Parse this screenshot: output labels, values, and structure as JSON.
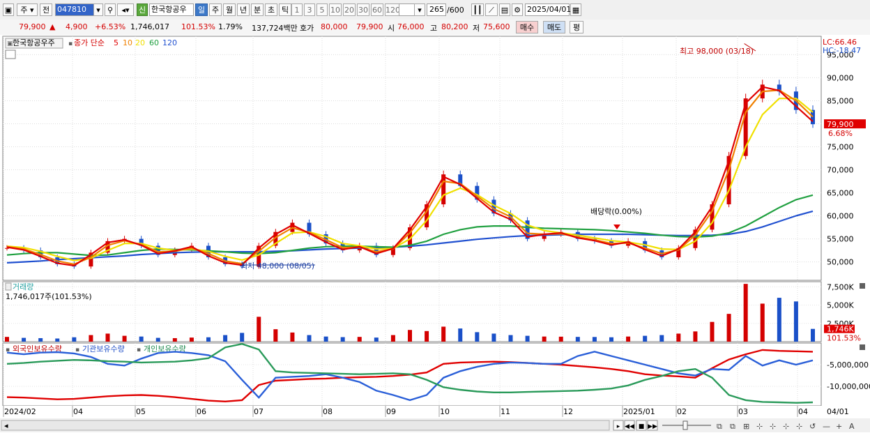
{
  "toolbar": {
    "market": "주",
    "prefix": "전",
    "code": "047810",
    "name": "한국항공우",
    "badge": "신",
    "periods": [
      "일",
      "주",
      "월",
      "년",
      "분",
      "초",
      "틱"
    ],
    "active_period": "일",
    "multipliers": [
      "1",
      "3",
      "5",
      "10",
      "20",
      "30",
      "60",
      "120"
    ],
    "count": "265",
    "count_total": "/600",
    "date": "2025/04/01"
  },
  "quote": {
    "price": "79,900",
    "direction": "▲",
    "change": "4,900",
    "change_rate": "+6.53%",
    "volume": "1,746,017",
    "volume_rate": "101.53%",
    "turnover": "1.79%",
    "value": "137,724백만",
    "ask_label": "호가",
    "ask1": "80,000",
    "ask2": "79,900",
    "open_label": "시",
    "open": "76,000",
    "high_label": "고",
    "high": "80,200",
    "low_label": "저",
    "low": "75,600",
    "buy": "매수",
    "sell": "매도",
    "avg": "평"
  },
  "colors": {
    "up": "#d40000",
    "down": "#1a50c8",
    "ma5": "#e00000",
    "ma10": "#f08000",
    "ma20": "#f0e000",
    "ma60": "#20a040",
    "ma120": "#2050d0"
  },
  "chart_data": [
    {
      "type": "line",
      "panel": "price",
      "title": "한국항공우주",
      "legend": [
        "종가 단순",
        "5",
        "10",
        "20",
        "60",
        "120"
      ],
      "yticks": [
        "95,000",
        "90,000",
        "85,000",
        "80,000",
        "75,000",
        "70,000",
        "65,000",
        "60,000",
        "55,000",
        "50,000"
      ],
      "ylim": [
        46000,
        99000
      ],
      "lc": "LC:66.46",
      "hc": "HC:-18.47",
      "last_price": "79,900",
      "last_rate": "6.68%",
      "annotations": {
        "high": "최고 98,000 (03/18)",
        "low": "최저 48,000 (08/05)",
        "dividend": "배당락(0.00%)"
      },
      "x": [
        "2024/02",
        "04",
        "05",
        "06",
        "07",
        "08",
        "09",
        "10",
        "11",
        "12",
        "2025/01",
        "02",
        "03",
        "04"
      ],
      "series": [
        {
          "name": "종가",
          "values": [
            53000,
            52500,
            51000,
            49500,
            49000,
            52000,
            54500,
            55000,
            53500,
            51500,
            52500,
            53500,
            51000,
            49500,
            49000,
            53500,
            56500,
            58500,
            56000,
            54000,
            52500,
            53500,
            51500,
            53000,
            57500,
            62500,
            69000,
            66500,
            63500,
            60500,
            59000,
            55000,
            56000,
            56500,
            55000,
            54500,
            53500,
            54500,
            52500,
            51000,
            53000,
            57000,
            62500,
            73000,
            85500,
            88500,
            87000,
            83000,
            79900
          ]
        },
        {
          "name": "5",
          "values": [
            53200,
            52600,
            51200,
            49700,
            49200,
            51600,
            54200,
            54800,
            53600,
            51800,
            52400,
            53300,
            51300,
            49800,
            49300,
            53000,
            56000,
            58000,
            56200,
            54300,
            52700,
            53300,
            51800,
            52900,
            57000,
            62000,
            68500,
            66800,
            63800,
            60800,
            59200,
            55400,
            56000,
            56300,
            55200,
            54600,
            53700,
            54300,
            52700,
            51300,
            52800,
            56500,
            62000,
            72000,
            84500,
            88000,
            87200,
            83800,
            80500
          ]
        },
        {
          "name": "10",
          "values": [
            53300,
            52800,
            51600,
            50200,
            49500,
            51000,
            53600,
            54600,
            53800,
            52200,
            52300,
            53000,
            51800,
            50200,
            49600,
            52300,
            55300,
            57400,
            56400,
            54800,
            53100,
            53200,
            52200,
            52800,
            56300,
            61000,
            67500,
            67000,
            64300,
            61500,
            59800,
            56200,
            56000,
            56100,
            55400,
            54800,
            54000,
            54100,
            53000,
            51800,
            52600,
            55800,
            61000,
            70000,
            82500,
            87000,
            87300,
            85000,
            81500
          ]
        },
        {
          "name": "20",
          "values": [
            53400,
            53100,
            52300,
            51200,
            50300,
            50800,
            52500,
            54000,
            54000,
            53000,
            52500,
            52800,
            52300,
            51200,
            50400,
            51500,
            54000,
            56300,
            56500,
            55500,
            54000,
            53500,
            52800,
            52900,
            55000,
            59000,
            64500,
            66000,
            64600,
            62300,
            60500,
            58000,
            56800,
            56300,
            55800,
            55200,
            54600,
            54300,
            53700,
            52800,
            52700,
            54500,
            58500,
            65500,
            75000,
            82000,
            85500,
            85500,
            82500
          ]
        },
        {
          "name": "60",
          "values": [
            51500,
            51800,
            52000,
            52000,
            51700,
            51400,
            51500,
            52000,
            52500,
            52800,
            52700,
            52600,
            52400,
            52200,
            51900,
            51800,
            52000,
            52500,
            53000,
            53300,
            53400,
            53400,
            53300,
            53200,
            53600,
            54500,
            56000,
            57000,
            57600,
            57800,
            57800,
            57500,
            57300,
            57200,
            57100,
            57000,
            56800,
            56500,
            56200,
            55800,
            55500,
            55400,
            55600,
            56300,
            57800,
            59800,
            61800,
            63500,
            64500
          ]
        },
        {
          "name": "120",
          "values": [
            49800,
            50000,
            50200,
            50500,
            50700,
            50900,
            51100,
            51300,
            51600,
            51800,
            52000,
            52100,
            52200,
            52200,
            52200,
            52200,
            52300,
            52400,
            52600,
            52800,
            52900,
            53000,
            53100,
            53200,
            53400,
            53700,
            54100,
            54500,
            54900,
            55200,
            55500,
            55700,
            55800,
            55900,
            56000,
            56000,
            56000,
            56000,
            55900,
            55800,
            55700,
            55700,
            55800,
            56000,
            56600,
            57600,
            58800,
            60000,
            61000
          ]
        }
      ]
    },
    {
      "type": "bar",
      "panel": "volume",
      "title": "거래량",
      "current": "1,746,017주(101.53%)",
      "yticks": [
        "7,500K",
        "5,000K",
        "2,500K"
      ],
      "ylim": [
        0,
        8200
      ],
      "last_label": "1,746K",
      "last_rate": "101.53%",
      "values": [
        650,
        520,
        480,
        430,
        600,
        900,
        1100,
        800,
        700,
        520,
        480,
        560,
        600,
        900,
        1200,
        3400,
        1700,
        1250,
        900,
        700,
        620,
        650,
        560,
        900,
        1600,
        1450,
        2050,
        1800,
        1300,
        1100,
        900,
        800,
        700,
        680,
        650,
        640,
        600,
        700,
        800,
        900,
        1100,
        1400,
        2700,
        3800,
        7900,
        5200,
        6000,
        5500,
        1746
      ]
    },
    {
      "type": "line",
      "panel": "holdings",
      "legend": [
        "외국인보유수량",
        "기관보유수량",
        "개인보유수량"
      ],
      "yticks": [
        "-5,000,000",
        "-10,000,000"
      ],
      "ylim": [
        -14500000,
        0
      ],
      "series": [
        {
          "name": "외국인보유수량",
          "values": [
            -12500000,
            -12600000,
            -12800000,
            -13000000,
            -12900000,
            -12600000,
            -12300000,
            -12100000,
            -12000000,
            -12200000,
            -12500000,
            -12900000,
            -13300000,
            -13500000,
            -13200000,
            -9700000,
            -8700000,
            -8500000,
            -8300000,
            -8200000,
            -8000000,
            -7900000,
            -7800000,
            -7600000,
            -7300000,
            -6800000,
            -4800000,
            -4500000,
            -4400000,
            -4300000,
            -4400000,
            -4600000,
            -4800000,
            -5000000,
            -5300000,
            -5600000,
            -6000000,
            -6500000,
            -7200000,
            -7500000,
            -7700000,
            -8000000,
            -5800000,
            -3800000,
            -2600000,
            -1600000,
            -1800000,
            -1900000,
            -2000000
          ]
        },
        {
          "name": "기관보유수량",
          "values": [
            -2200000,
            -2600000,
            -2200000,
            -2100000,
            -2400000,
            -3200000,
            -4800000,
            -5200000,
            -3600000,
            -2300000,
            -2000000,
            -2300000,
            -2800000,
            -4200000,
            -8500000,
            -12600000,
            -8000000,
            -7800000,
            -7600000,
            -7200000,
            -8000000,
            -9000000,
            -11000000,
            -12000000,
            -13200000,
            -12000000,
            -8000000,
            -6500000,
            -5500000,
            -4800000,
            -4500000,
            -4600000,
            -4800000,
            -4800000,
            -3000000,
            -2000000,
            -3000000,
            -4000000,
            -5000000,
            -6000000,
            -7000000,
            -7500000,
            -6000000,
            -6200000,
            -3000000,
            -5200000,
            -4000000,
            -5000000,
            -4000000
          ]
        },
        {
          "name": "개인보유수량",
          "values": [
            -4800000,
            -4600000,
            -4300000,
            -4100000,
            -3900000,
            -4000000,
            -4200000,
            -4300000,
            -4500000,
            -4400000,
            -4300000,
            -4000000,
            -3500000,
            -1000000,
            -200000,
            -1500000,
            -6500000,
            -6800000,
            -6900000,
            -7000000,
            -7100000,
            -7200000,
            -7100000,
            -7000000,
            -7200000,
            -8500000,
            -10200000,
            -10800000,
            -11200000,
            -11400000,
            -11400000,
            -11300000,
            -11200000,
            -11100000,
            -11000000,
            -10800000,
            -10500000,
            -9800000,
            -8500000,
            -7600000,
            -6500000,
            -6000000,
            -8000000,
            -12000000,
            -13200000,
            -13600000,
            -13700000,
            -13800000,
            -13700000
          ]
        }
      ]
    }
  ],
  "xaxis": {
    "labels": [
      "2024/02",
      "04",
      "05",
      "06",
      "07",
      "08",
      "09",
      "10",
      "11",
      "12",
      "2025/01",
      "02",
      "03",
      "04"
    ],
    "right_label": "04/01"
  }
}
